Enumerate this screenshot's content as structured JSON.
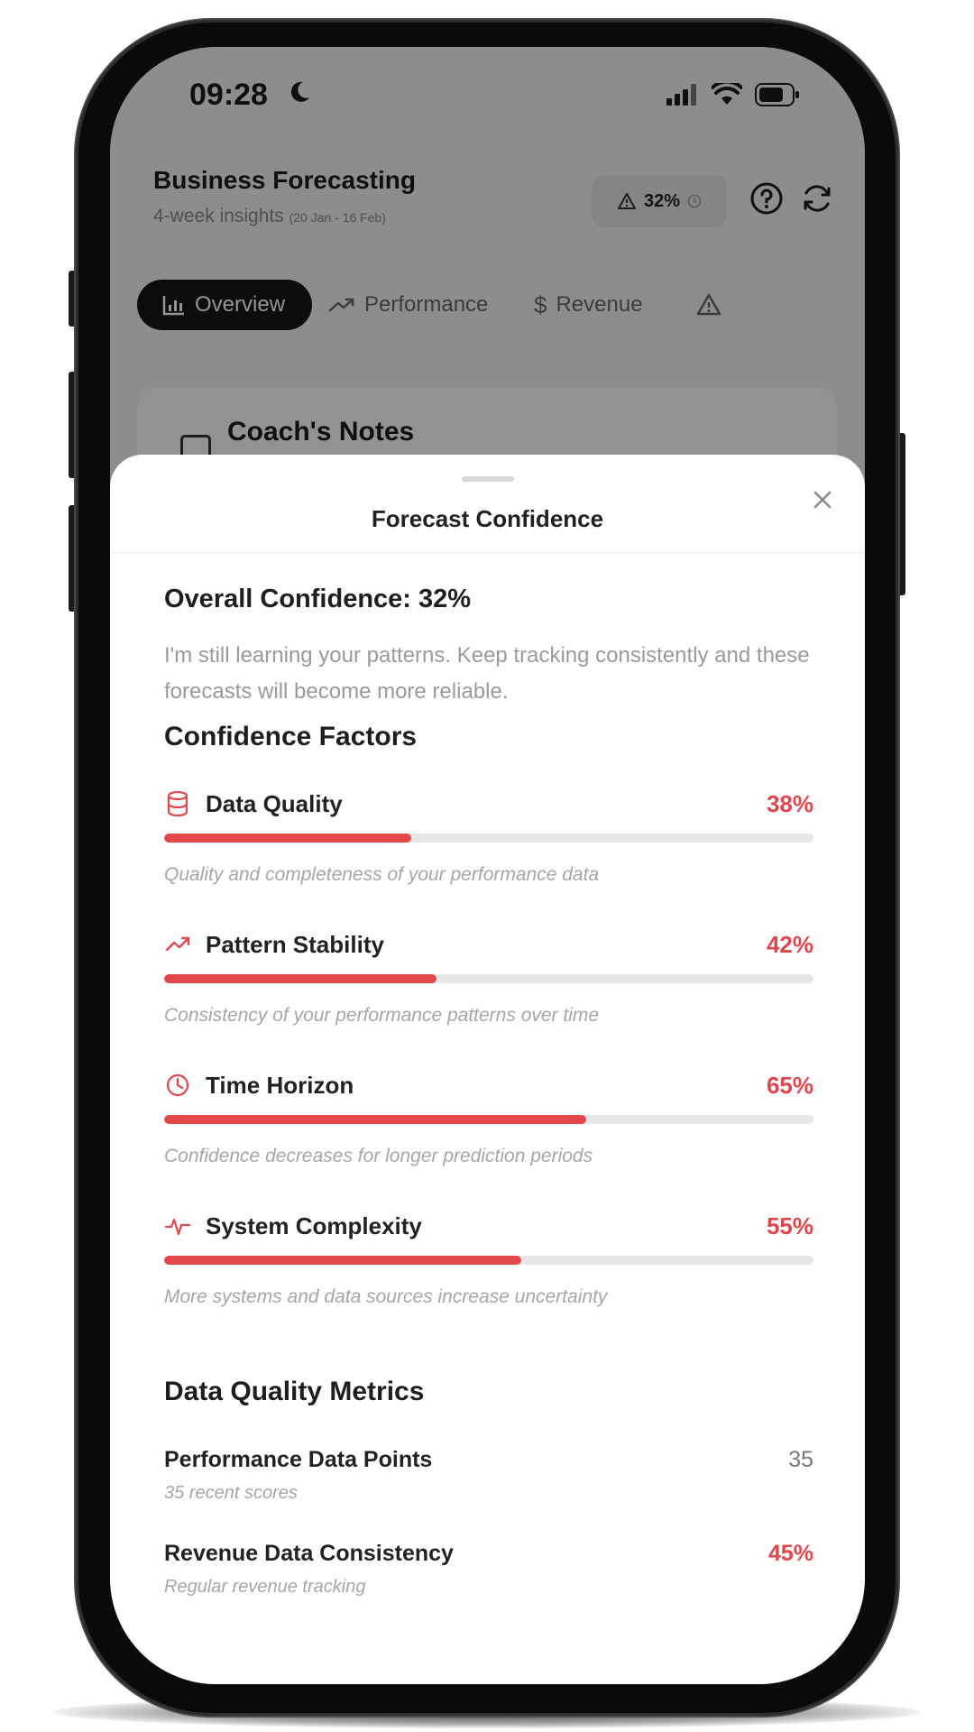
{
  "status_bar": {
    "time": "09:28"
  },
  "app": {
    "title": "Business Forecasting",
    "subtitle": "4-week insights",
    "date_range": "(20 Jan - 16 Feb)",
    "confidence_badge": "32%",
    "tabs": [
      {
        "label": "Overview",
        "icon": "bar-chart-icon",
        "active": true
      },
      {
        "label": "Performance",
        "icon": "trending-up-icon",
        "active": false
      },
      {
        "label": "Revenue",
        "icon": "dollar-icon",
        "active": false
      }
    ],
    "card_title": "Coach's Notes"
  },
  "sheet": {
    "title": "Forecast Confidence",
    "overall_heading": "Overall Confidence: 32%",
    "overall_description": "I'm still learning your patterns. Keep tracking consistently and these forecasts will become more reliable.",
    "factors_heading": "Confidence Factors",
    "factors": [
      {
        "label": "Data Quality",
        "percent_text": "38%",
        "value": 38,
        "description": "Quality and completeness of your performance data",
        "icon": "database-icon"
      },
      {
        "label": "Pattern Stability",
        "percent_text": "42%",
        "value": 42,
        "description": "Consistency of your performance patterns over time",
        "icon": "trending-up-icon"
      },
      {
        "label": "Time Horizon",
        "percent_text": "65%",
        "value": 65,
        "description": "Confidence decreases for longer prediction periods",
        "icon": "clock-icon"
      },
      {
        "label": "System Complexity",
        "percent_text": "55%",
        "value": 55,
        "description": "More systems and data sources increase uncertainty",
        "icon": "activity-icon"
      }
    ],
    "metrics_heading": "Data Quality Metrics",
    "metrics": [
      {
        "label": "Performance Data Points",
        "value": "35",
        "sub": "35 recent scores"
      },
      {
        "label": "Revenue Data Consistency",
        "value": "45%",
        "sub": "Regular revenue tracking"
      }
    ]
  },
  "colors": {
    "accent": "#e2474b",
    "track": "#e6e6e6",
    "active_tab": "#151515"
  }
}
